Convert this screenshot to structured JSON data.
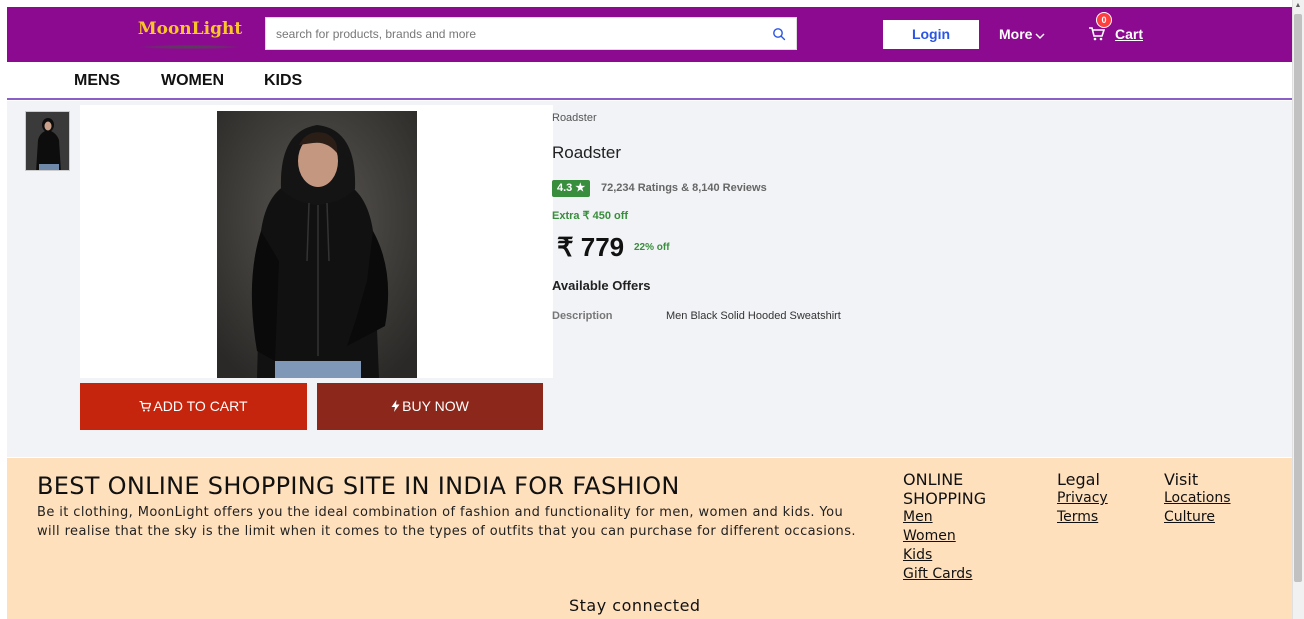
{
  "colors": {
    "header_bg": "#8b0a8f",
    "logo": "#f9c52a",
    "login_text": "#2a55e5",
    "add_to_cart": "#c5250d",
    "buy_now": "#8b281b",
    "rating_green": "#388e3c",
    "footer_bg": "#ffe0bd",
    "nav_underline": "#8a5fc8"
  },
  "header": {
    "logo": "MoonLight",
    "search_placeholder": "search for products, brands and more",
    "search_icon": "search-icon",
    "login_label": "Login",
    "more_label": "More",
    "cart_count": "0",
    "cart_label": "Cart"
  },
  "nav": {
    "categories": [
      "MENS",
      "WOMEN",
      "KIDS"
    ]
  },
  "product": {
    "brand_small": "Roadster",
    "title": "Roadster",
    "rating": "4.3",
    "rating_star": "★",
    "ratings_reviews": "72,234 Ratings & 8,140 Reviews",
    "extra_off": "Extra ₹ 450 off",
    "price": "₹ 779",
    "discount": "22% off",
    "offers_heading": "Available Offers",
    "description_label": "Description",
    "description_value": "Men Black Solid Hooded Sweatshirt",
    "add_to_cart_label": "ADD TO CART",
    "buy_now_label": "BUY NOW"
  },
  "footer": {
    "title": "BEST ONLINE SHOPPING SITE IN INDIA FOR FASHION",
    "paragraph": "Be it clothing, MoonLight offers you the ideal combination of fashion and functionality for men, women and kids. You will realise that the sky is the limit when it comes to the types of outfits that you can purchase for different occasions.",
    "col1_heading": "ONLINE SHOPPING",
    "col1_links": [
      "Men",
      "Women",
      "Kids",
      "Gift Cards"
    ],
    "col2_heading": "Legal",
    "col2_links": [
      "Privacy",
      "Terms"
    ],
    "col3_heading": "Visit",
    "col3_links": [
      "Locations",
      "Culture"
    ],
    "stay_connected": "Stay connected"
  }
}
